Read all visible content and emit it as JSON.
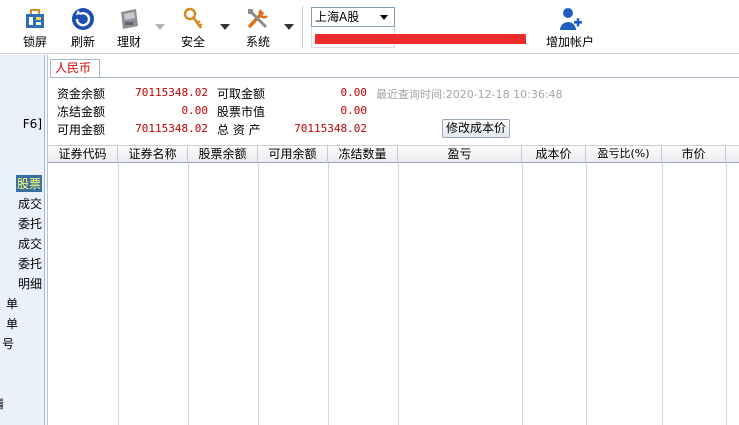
{
  "toolbar": {
    "lock_label": "锁屏",
    "refresh_label": "刷新",
    "finance_label": "理财",
    "security_label": "安全",
    "system_label": "系统",
    "add_account_label": "增加帐户"
  },
  "market_select": {
    "selected": "上海A股"
  },
  "left_panel": {
    "items": [
      {
        "label": "F6]",
        "active": false
      },
      {
        "label": "股票",
        "active": true
      },
      {
        "label": "成交",
        "active": false
      },
      {
        "label": "委托",
        "active": false
      },
      {
        "label": "成交",
        "active": false
      },
      {
        "label": "委托",
        "active": false
      },
      {
        "label": "明细",
        "active": false
      },
      {
        "label": "单",
        "active": false
      },
      {
        "label": "单",
        "active": false
      },
      {
        "label": "号",
        "active": false
      },
      {
        "label": "情",
        "active": false
      }
    ]
  },
  "tab": {
    "label": "人民币"
  },
  "summary": {
    "fund_balance_label": "资金余额",
    "fund_balance": "70115348.02",
    "withdrawable_label": "可取金额",
    "withdrawable": "0.00",
    "frozen_label": "冻结金额",
    "frozen": "0.00",
    "stock_value_label": "股票市值",
    "stock_value": "0.00",
    "available_label": "可用金额",
    "available": "70115348.02",
    "total_assets_label": "总 资 产",
    "total_assets": "70115348.02",
    "last_query": "最近查询时间:2020-12-18 10:36:48",
    "modify_cost_label": "修改成本价"
  },
  "table": {
    "columns": [
      "证券代码",
      "证券名称",
      "股票余额",
      "可用余额",
      "冻结数量",
      "盈亏",
      "成本价",
      "盈亏比(%)",
      "市价"
    ],
    "rows": []
  },
  "colors": {
    "accent_red": "#c00000",
    "mask_red": "#ef2b2b",
    "panel_bg": "#eaf1fa"
  }
}
